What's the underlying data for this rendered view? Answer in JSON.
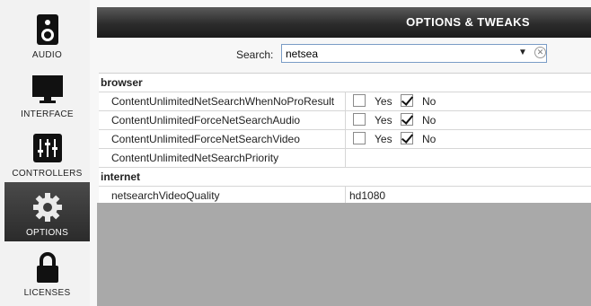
{
  "sidebar": {
    "items": [
      {
        "label": "AUDIO",
        "icon": "speaker-icon"
      },
      {
        "label": "INTERFACE",
        "icon": "monitor-icon"
      },
      {
        "label": "CONTROLLERS",
        "icon": "sliders-icon"
      },
      {
        "label": "OPTIONS",
        "icon": "gear-icon",
        "active": true
      },
      {
        "label": "LICENSES",
        "icon": "lock-icon"
      }
    ]
  },
  "header": {
    "title": "OPTIONS & TWEAKS"
  },
  "search": {
    "label": "Search:",
    "value": "netsea"
  },
  "sections": [
    {
      "name": "browser",
      "options": [
        {
          "name": "ContentUnlimitedNetSearchWhenNoProResult",
          "yes_label": "Yes",
          "no_label": "No",
          "yes_checked": false,
          "no_checked": true
        },
        {
          "name": "ContentUnlimitedForceNetSearchAudio",
          "yes_label": "Yes",
          "no_label": "No",
          "yes_checked": false,
          "no_checked": true
        },
        {
          "name": "ContentUnlimitedForceNetSearchVideo",
          "yes_label": "Yes",
          "no_label": "No",
          "yes_checked": false,
          "no_checked": true
        },
        {
          "name": "ContentUnlimitedNetSearchPriority",
          "value": ""
        }
      ]
    },
    {
      "name": "internet",
      "options": [
        {
          "name": "netsearchVideoQuality",
          "value": "hd1080"
        }
      ]
    }
  ]
}
